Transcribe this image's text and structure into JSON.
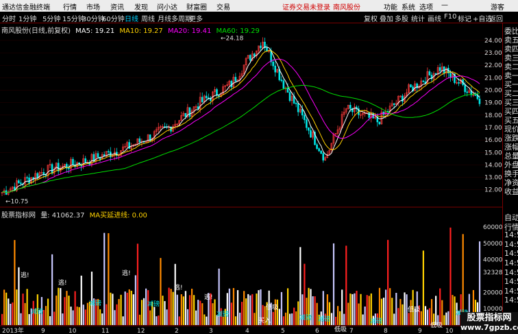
{
  "topbar": {
    "app": "通达信金融终端",
    "menu": [
      "行情",
      "市场",
      "资讯",
      "发现",
      "问小达",
      "财富圈",
      "交易"
    ],
    "notice": "证券交易未登录",
    "stock": "南风股份",
    "right": [
      "功能",
      "系统",
      "选项"
    ],
    "user": "游客"
  },
  "toolbar": {
    "periods": [
      "分时",
      "1分钟",
      "5分钟",
      "15分钟",
      "30分钟",
      "60分钟",
      "日线",
      "周线",
      "月线",
      "多周期",
      "更多"
    ],
    "active": "日线",
    "right": [
      "复权",
      "叠加",
      "多股",
      "统计",
      "画线",
      "F10",
      "标记",
      "+自选",
      "返回"
    ]
  },
  "info1": {
    "name": "南风股份(日线,前复权)",
    "ma5": "MA5: 19.21",
    "ma10": "MA10: 19.27",
    "ma20": "MA20: 19.41",
    "ma60": "MA60: 19.29"
  },
  "info2": {
    "name": "股票指标网",
    "vol": "量: 41062.37",
    "ma": "MA买延进线: 0.00"
  },
  "price_labels": {
    "high": "24.18",
    "low": "10.75"
  },
  "right_panel": [
    "委比",
    "卖五",
    "卖四",
    "卖三",
    "卖二",
    "卖一",
    "买一",
    "买二",
    "买三",
    "买四",
    "买五",
    "现价",
    "涨跌",
    "涨幅",
    "总量",
    "外盘",
    "换手",
    "净资",
    "收益",
    "",
    "自动",
    "行情",
    "14:56",
    "14:56",
    "14:56",
    "14:56",
    "14:56",
    "14:56",
    "14:56",
    "14:56"
  ],
  "yaxis": [
    "24.00",
    "23.00",
    "22.00",
    "21.00",
    "20.00",
    "19.00",
    "18.00",
    "17.00",
    "16.00",
    "15.00",
    "14.00",
    "13.00",
    "12.00"
  ],
  "vol_ticks": [
    "60000",
    "50000",
    "40000",
    "32328.45",
    "20000",
    "10000"
  ],
  "xaxis": [
    "2013年",
    "9",
    "10",
    "11",
    "12",
    "2",
    "3",
    "4",
    "5",
    "6",
    "7",
    "8",
    "9",
    "10",
    "11"
  ],
  "annotations": [
    "逃!",
    "逃!",
    "逃!",
    "逃!",
    "逃!",
    "减磅",
    "减磅",
    "减磅",
    "减磅",
    "减磅",
    "减磅",
    "减磅",
    "减磅",
    "低吸",
    "低吸",
    "低吸",
    "低吸",
    "买入"
  ],
  "watermark": {
    "line1": "股票指标网",
    "line2": "www.7gpzb.com"
  },
  "colors": {
    "up": "#ff3c3c",
    "down": "#00e6e6",
    "ma5": "#ffffff",
    "ma10": "#ffd200",
    "ma20": "#ff00ff",
    "ma60": "#00e000",
    "grid": "#7a0000"
  }
}
